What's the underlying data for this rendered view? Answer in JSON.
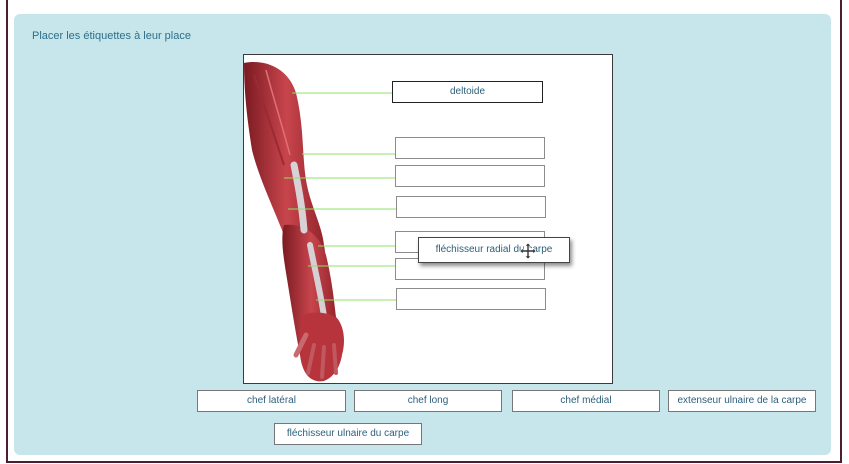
{
  "instruction": "Placer les étiquettes à leur place",
  "slots": [
    {
      "name": "slot-1",
      "value": "deltoide",
      "filled": true
    },
    {
      "name": "slot-2",
      "value": "",
      "filled": false
    },
    {
      "name": "slot-3",
      "value": "",
      "filled": false
    },
    {
      "name": "slot-4",
      "value": "",
      "filled": false
    },
    {
      "name": "slot-5",
      "value": "",
      "filled": false
    },
    {
      "name": "slot-6",
      "value": "",
      "filled": false
    },
    {
      "name": "slot-7",
      "value": "",
      "filled": false
    }
  ],
  "dragging_label": "fléchisseur radial du carpe",
  "label_bank": [
    "chef latéral",
    "chef long",
    "chef médial",
    "extenseur ulnaire de la carpe",
    "fléchisseur ulnaire du carpe"
  ],
  "icons": {
    "cursor": "move-cursor-icon"
  },
  "colors": {
    "panel": "#c6e6ec",
    "leader_line": "#8fe06a",
    "text": "#2d5f7a"
  }
}
